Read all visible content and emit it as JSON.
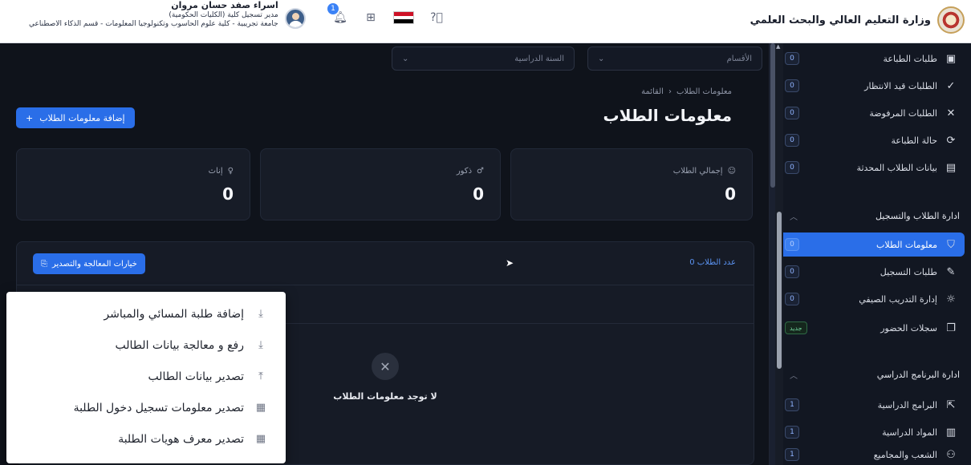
{
  "header": {
    "brand_title": "وزارة التعليم العالي والبحث العلمي",
    "user_name": "اسراء صفد حسان مروان",
    "user_role": "مدير تسجيل كلية (الكليات الحكومية)",
    "user_org": "جامعة تجريبية - كلية علوم الحاسوب وتكنولوجيا المعلومات - قسم الذكاء الاصطناعي",
    "notification_count": "1",
    "flag_colors": [
      "#ce1126",
      "#ffffff",
      "#000000"
    ]
  },
  "sidebar": {
    "items_top": [
      {
        "label": "طلبات الطباعة",
        "count": "0",
        "icon": "id-card-icon"
      },
      {
        "label": "الطلبات قيد الانتظار",
        "count": "0",
        "icon": "check-icon"
      },
      {
        "label": "الطلبات المرفوضة",
        "count": "0",
        "icon": "x-icon"
      },
      {
        "label": "حالة الطباعة",
        "count": "0",
        "icon": "refresh-icon"
      },
      {
        "label": "بيانات الطلاب المحدثة",
        "count": "0",
        "icon": "file-icon"
      }
    ],
    "section_students": "ادارة الطلاب والتسجيل",
    "items_students": [
      {
        "label": "معلومات الطلاب",
        "count": "0",
        "icon": "graduate-icon"
      },
      {
        "label": "طلبات التسجيل",
        "count": "0",
        "icon": "edit-icon"
      },
      {
        "label": "إدارة التدريب الصيفي",
        "count": "0",
        "icon": "sun-icon"
      },
      {
        "label": "سجلات الحضور",
        "new_badge": "جديد",
        "icon": "clipboard-icon"
      }
    ],
    "section_program": "ادارة البرنامج الدراسي",
    "items_program": [
      {
        "label": "البرامج الدراسية",
        "count": "1",
        "icon": "program-icon"
      },
      {
        "label": "المواد الدراسية",
        "count": "1",
        "icon": "books-icon"
      },
      {
        "label": "الشعب والمجاميع",
        "count": "1",
        "icon": "tree-icon"
      }
    ]
  },
  "main": {
    "filter_year_placeholder": "السنة الدراسية",
    "filter_dept_placeholder": "الأقسام",
    "breadcrumb_home": "القائمة",
    "breadcrumb_current": "معلومات الطلاب",
    "page_title": "معلومات الطلاب",
    "add_button": "إضافة معلومات الطلاب",
    "stats": [
      {
        "label": "إجمالي الطلاب",
        "value": "0",
        "icon": "users-icon"
      },
      {
        "label": "ذكور",
        "value": "0",
        "icon": "male-icon"
      },
      {
        "label": "إناث",
        "value": "0",
        "icon": "female-icon"
      }
    ],
    "student_count_label": "عدد الطلاب 0",
    "process_button": "خيارات المعالجة والتصدير",
    "empty_text": "لا توجد معلومات الطلاب"
  },
  "dropdown": {
    "items": [
      {
        "label": "إضافة طلبة المسائي والمباشر",
        "icon": "download-icon"
      },
      {
        "label": "رفع و معالجة بيانات الطالب",
        "icon": "download-icon"
      },
      {
        "label": "تصدير بيانات الطالب",
        "icon": "upload-icon"
      },
      {
        "label": "تصدير معلومات تسجيل دخول الطلبة",
        "icon": "qr-icon"
      },
      {
        "label": "تصدير معرف هويات الطلبة",
        "icon": "qr-icon"
      }
    ]
  }
}
